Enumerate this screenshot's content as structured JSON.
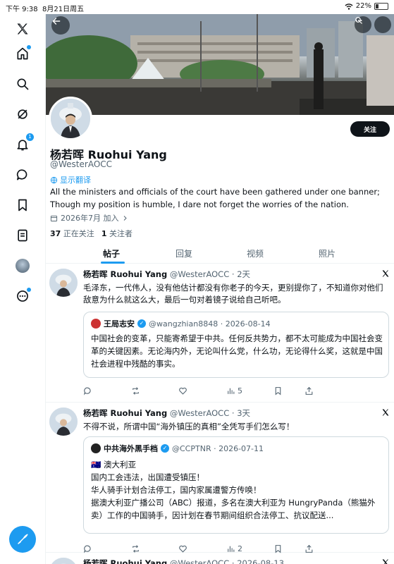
{
  "status_bar": {
    "time": "下午 9:38",
    "date": "8月21日周五",
    "battery": "22%"
  },
  "sidebar": {
    "items": [
      {
        "name": "x-logo"
      },
      {
        "name": "home"
      },
      {
        "name": "explore"
      },
      {
        "name": "grok"
      },
      {
        "name": "notifications",
        "badge": "1"
      },
      {
        "name": "messages"
      },
      {
        "name": "bookmarks"
      },
      {
        "name": "lists"
      },
      {
        "name": "profile"
      },
      {
        "name": "more"
      }
    ],
    "accent": "#1d9bf0"
  },
  "profile": {
    "display_name": "杨若晖 Ruohui Yang",
    "handle": "@WesterAOCC",
    "follow_label": "关注",
    "translate_label": "显示翻译",
    "bio_line1": "All the ministers and officials of the court have been gathered under one banner;",
    "bio_line2": "Though my position is humble, I dare not forget the worries of the nation.",
    "joined": "2026年7月 加入",
    "following_count": "37",
    "following_label": "正在关注",
    "followers_count": "1",
    "followers_label": "关注者"
  },
  "tabs": [
    {
      "label": "帖子",
      "active": true
    },
    {
      "label": "回复",
      "active": false
    },
    {
      "label": "视频",
      "active": false
    },
    {
      "label": "照片",
      "active": false
    }
  ],
  "posts": [
    {
      "author": "杨若晖 Ruohui Yang",
      "meta": "@WesterAOCC · 2天",
      "text": "毛泽东，一代伟人，没有他估计都没有你老子的今天，更别提你了，不知道你对他们敌意为什么就这么大，最后一句对着镜子说给自己听吧。",
      "quote": {
        "author": "王局志安",
        "meta": "@wangzhian8848 · 2026-08-14",
        "text": "中国社会的变革，只能寄希望于中共。任何反共势力，都不太可能成为中国社会变革的关键因素。无论海内外，无论叫什么党，什么功，无论得什么奖，这就是中国社会进程中残酷的事实。"
      },
      "views": "5"
    },
    {
      "author": "杨若晖 Ruohui Yang",
      "meta": "@WesterAOCC · 3天",
      "text": "不得不说，所谓中国“海外镇压的真相”全凭写手们怎么写！",
      "quote": {
        "author": "中共海外黑手档",
        "meta": "@CCPTNR · 2026-07-11",
        "line1": "🇦🇺 澳大利亚",
        "line2": "国内工会违法，出国遭受镇压！",
        "line3": "华人骑手计划合法停工，国内家属遭警方传唤！",
        "line4": "据澳大利亚广播公司（ABC）报道，多名在澳大利亚为 HungryPanda（熊猫外卖）工作的中国骑手，因计划在春节期间组织合法停工、抗议配送..."
      },
      "views": "2"
    },
    {
      "author": "杨若晖 Ruohui Yang",
      "meta": "@WesterAOCC · 2026-08-13"
    }
  ]
}
